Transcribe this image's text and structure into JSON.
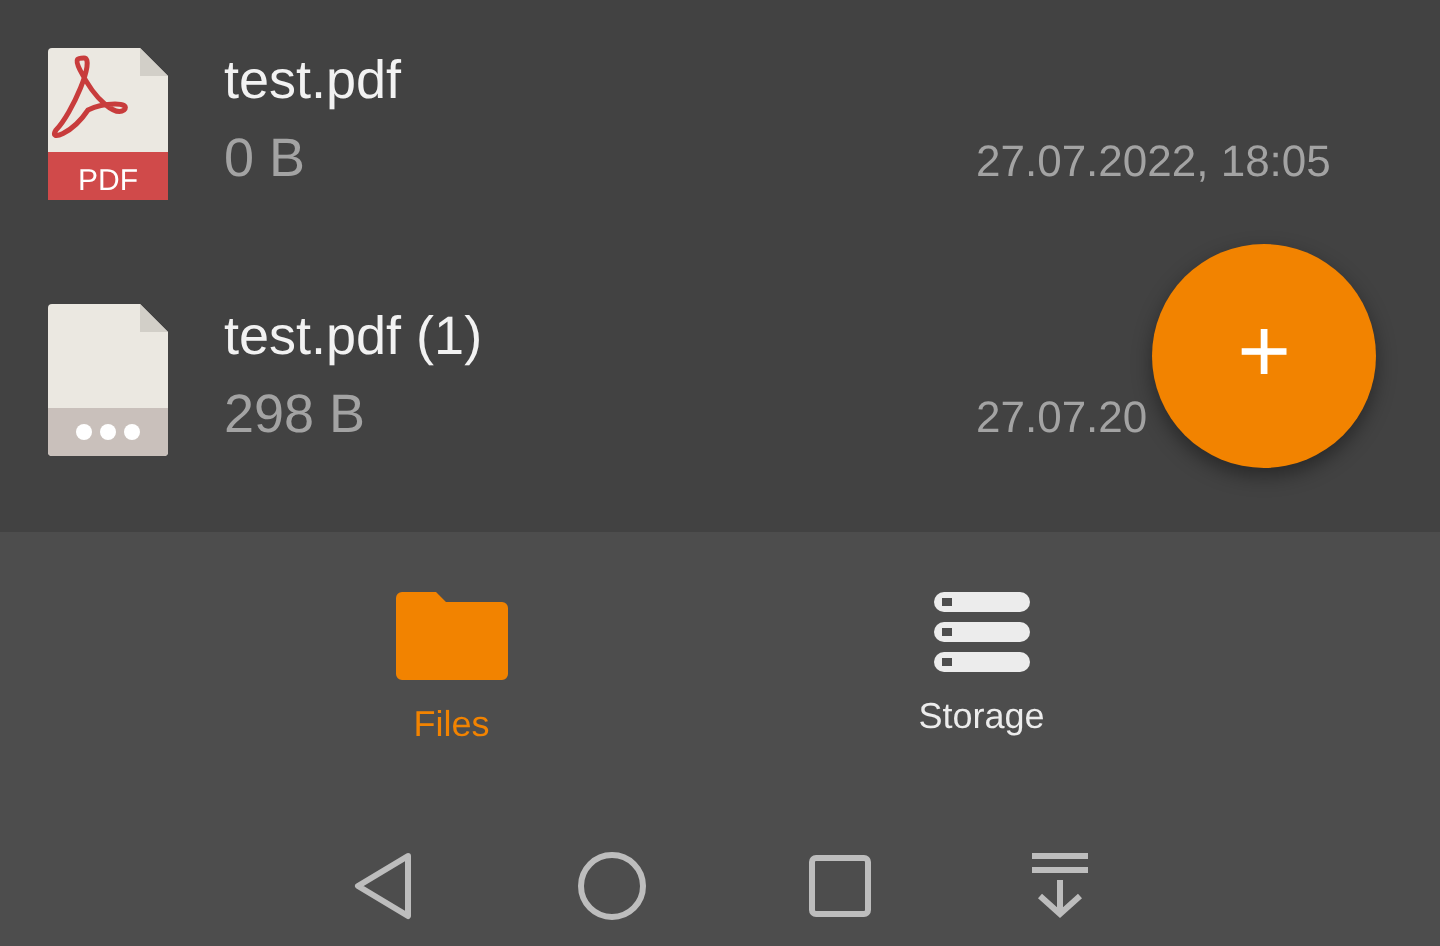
{
  "files": [
    {
      "name": "test.pdf",
      "size": "0 B",
      "date": "27.07.2022, 18:05",
      "kind": "pdf",
      "icon_label": "PDF"
    },
    {
      "name": "test.pdf (1)",
      "size": "298 B",
      "date": "27.07.20",
      "kind": "generic"
    }
  ],
  "fab": {
    "label": "+"
  },
  "tabs": [
    {
      "label": "Files",
      "selected": true,
      "kind": "folder"
    },
    {
      "label": "Storage",
      "selected": false,
      "kind": "storage"
    }
  ]
}
